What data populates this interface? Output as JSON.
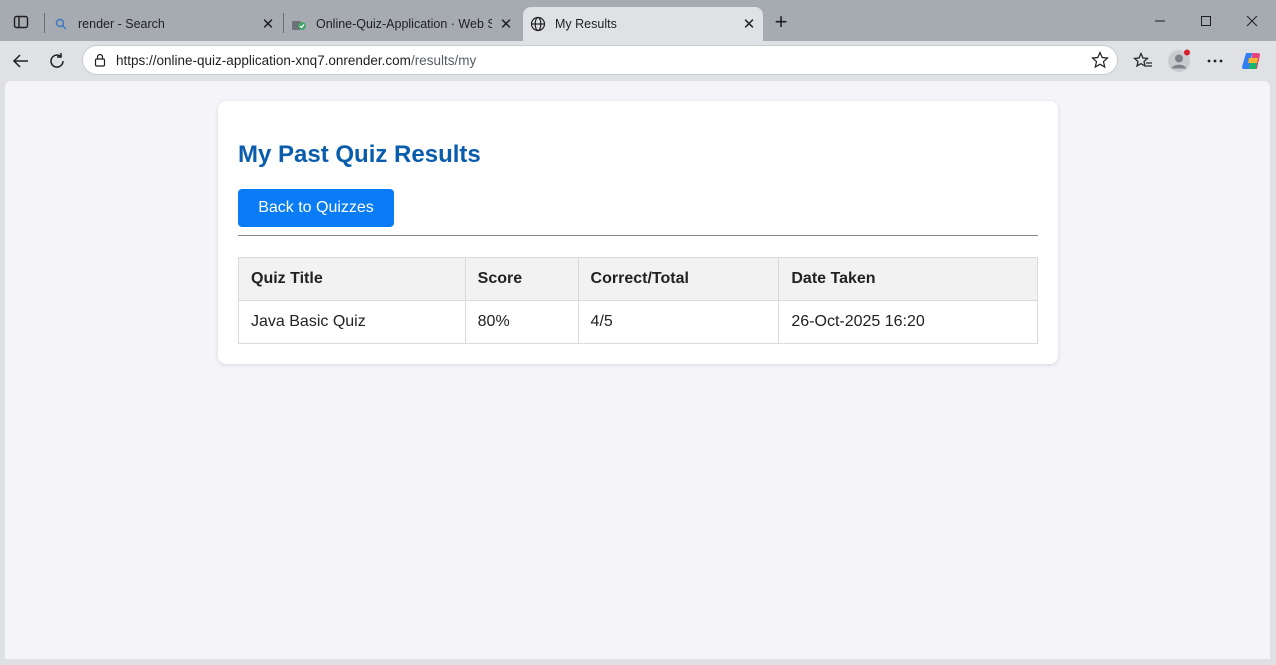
{
  "browser": {
    "tabs": [
      {
        "title": "render - Search",
        "favicon": "search-icon",
        "active": false
      },
      {
        "title": "Online-Quiz-Application · Web Se",
        "favicon": "render-icon",
        "active": false
      },
      {
        "title": "My Results",
        "favicon": "globe-icon",
        "active": true
      }
    ],
    "url_main": "https://online-quiz-application-xnq7.onrender.com",
    "url_path": "/results/my"
  },
  "page": {
    "title": "My Past Quiz Results",
    "back_button": "Back to Quizzes",
    "table": {
      "headers": [
        "Quiz Title",
        "Score",
        "Correct/Total",
        "Date Taken"
      ],
      "rows": [
        [
          "Java Basic Quiz",
          "80%",
          "4/5",
          "26-Oct-2025 16:20"
        ]
      ]
    }
  },
  "colors": {
    "title": "#0a5dad",
    "button": "#0a7cf5",
    "page_bg": "#f4f4f9"
  }
}
